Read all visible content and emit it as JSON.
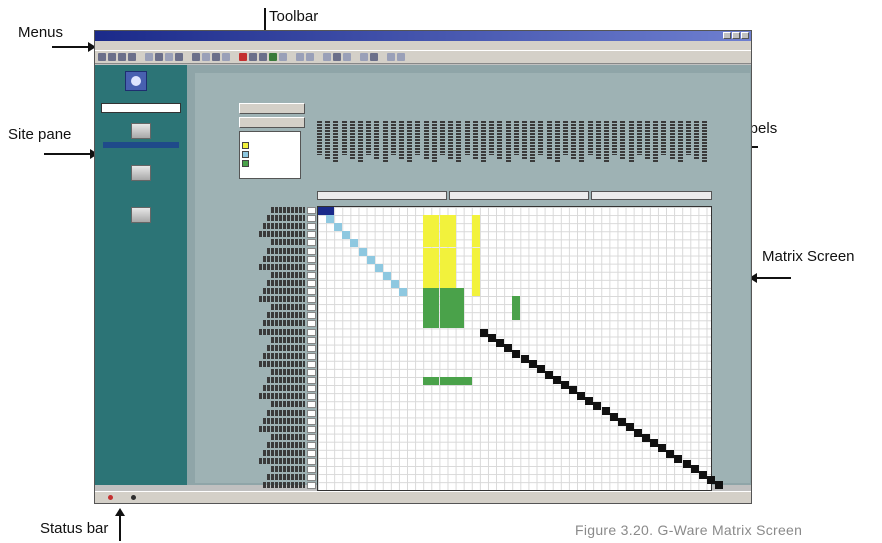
{
  "annotations": {
    "menus": "Menus",
    "toolbar": "Toolbar",
    "site_pane": "Site pane",
    "labels": "Labels",
    "matrix_screen": "Matrix Screen",
    "status_bar": "Status bar"
  },
  "figure_caption": "Figure 3.20. G-Ware Matrix Screen",
  "colors": {
    "routed": "#f2f23c",
    "not_routed": "#8ec8e0",
    "cross_point": "#4aa24a",
    "diagonal": "#111111",
    "site_pane_bg": "#2c7476",
    "matrix_bg": "#9eb2b4"
  },
  "icons": [
    "app-logo-icon",
    "computer-icon",
    "toolbar-button-icon"
  ]
}
